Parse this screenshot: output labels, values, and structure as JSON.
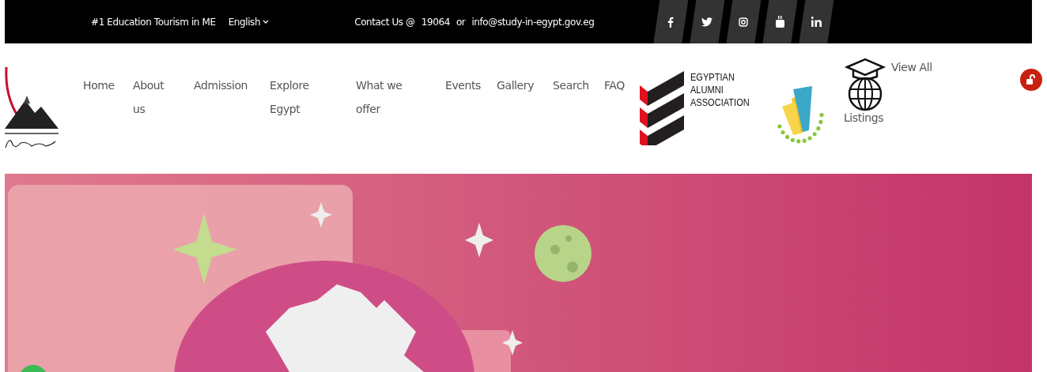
{
  "top_bar": {
    "tagline": "#1 Education Tourism in ME",
    "language": {
      "label": "English",
      "expanded": false
    },
    "contact": {
      "label": "Contact Us @",
      "phone": "19064",
      "separator": "or",
      "email": "info@study-in-egypt.gov.eg"
    },
    "social": [
      {
        "kind": "facebook"
      },
      {
        "kind": "twitter"
      },
      {
        "kind": "instagram"
      },
      {
        "kind": "youtube"
      },
      {
        "kind": "linkedin"
      }
    ]
  },
  "nav": {
    "items": [
      {
        "label": "Home"
      },
      {
        "label": "About us"
      },
      {
        "label": "Admission"
      },
      {
        "label": "Explore Egypt"
      },
      {
        "label": "What we offer"
      },
      {
        "label": "Events"
      },
      {
        "label": "Gallery"
      },
      {
        "label": "Search"
      },
      {
        "label": "FAQ"
      }
    ],
    "alumni_logo": {
      "lines": [
        "EGYPTIAN",
        "ALUMNI",
        "ASSOCIATION"
      ]
    },
    "listings_link": {
      "first": "View All",
      "second": "Listings"
    }
  }
}
